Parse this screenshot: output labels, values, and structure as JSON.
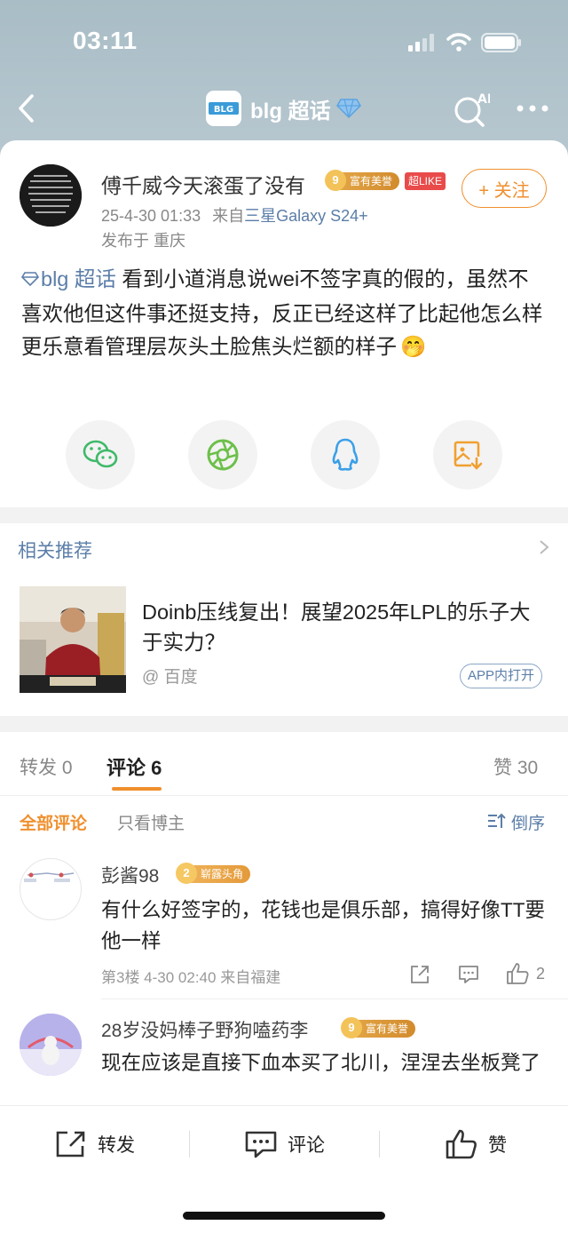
{
  "status_bar": {
    "time": "03:11"
  },
  "nav": {
    "title": "blg 超话",
    "logo_text": "BLG"
  },
  "post": {
    "username": "傅千威今天滚蛋了没有",
    "badge_rich_level": "9",
    "badge_rich_label": "富有美誉",
    "badge_chao": "超LIKE",
    "follow_label": "+ 关注",
    "date": "25-4-30 01:33",
    "from_prefix": "来自",
    "device": "三星Galaxy S24+",
    "location": "发布于 重庆",
    "topic": "blg 超话",
    "text": " 看到小道消息说wei不签字真的假的，虽然不喜欢他但这件事还挺支持，反正已经这样了比起他怎么样更乐意看管理层灰头土脸焦头烂额的样子",
    "emoji": "🤭"
  },
  "share_icons": [
    "wechat-icon",
    "moments-icon",
    "qq-icon",
    "save-image-icon"
  ],
  "related": {
    "title": "相关推荐",
    "headline": "Doinb压线复出！展望2025年LPL的乐子大于实力？",
    "source": "@ 百度",
    "app_open": "APP内打开"
  },
  "tabs": {
    "repost": "转发 0",
    "comment": "评论 6",
    "like": "赞 30"
  },
  "filter": {
    "all": "全部评论",
    "host_only": "只看博主",
    "sort": "倒序"
  },
  "comments": [
    {
      "name": "彭酱98",
      "badge_level": "2",
      "badge_label": "崭露头角",
      "text": "有什么好签字的，花钱也是俱乐部，搞得好像TT要他一样",
      "meta": "第3楼 4-30 02:40 来自福建",
      "likes": "2"
    },
    {
      "name": "28岁没妈棒子野狗嗑药李",
      "badge_level": "9",
      "badge_label": "富有美誉",
      "text": "现在应该是直接下血本买了北川，涅涅去坐板凳了"
    }
  ],
  "bottom_bar": {
    "repost": "转发",
    "comment": "评论",
    "like": "赞"
  },
  "colors": {
    "accent": "#f08f2d",
    "link": "#5b7ea8"
  }
}
